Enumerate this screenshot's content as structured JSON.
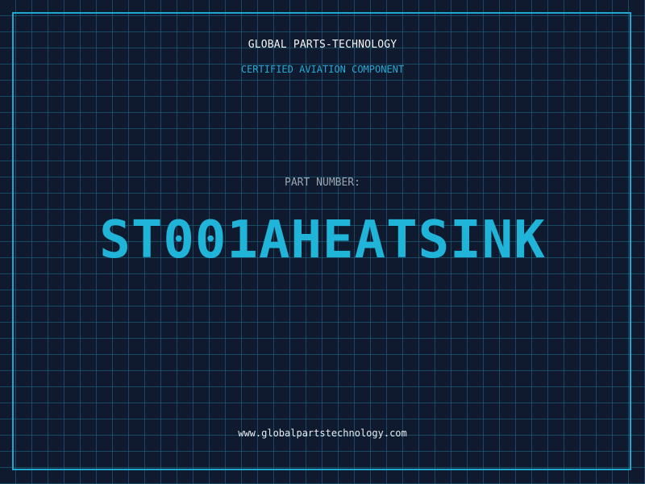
{
  "header": {
    "company": "GLOBAL PARTS-TECHNOLOGY",
    "tagline": "CERTIFIED AVIATION COMPONENT"
  },
  "part": {
    "label": "PART NUMBER:",
    "number": "ST001AHEATSINK"
  },
  "footer": {
    "website": "www.globalpartstechnology.com"
  },
  "colors": {
    "background": "#0f1a2e",
    "grid": "#1e6e8c",
    "accent": "#1fb4d8",
    "frame": "#1ea7cf"
  }
}
